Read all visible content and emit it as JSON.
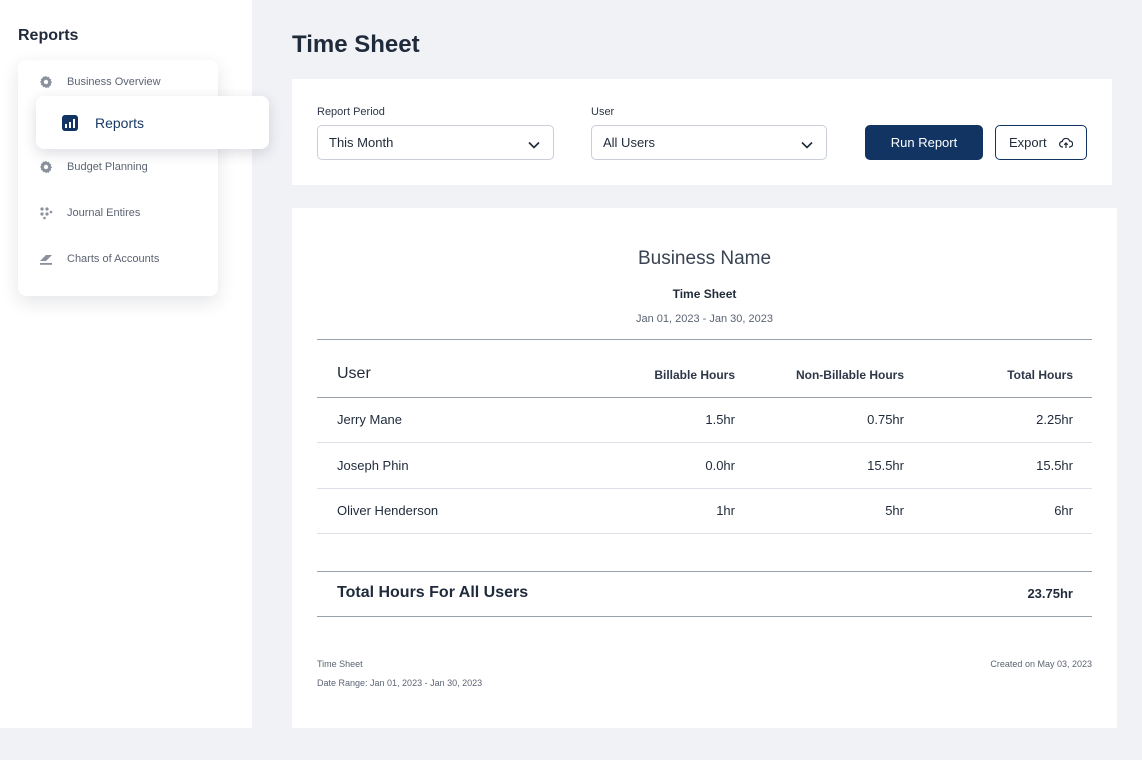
{
  "sidebar": {
    "title": "Reports",
    "items": [
      {
        "label": "Business Overview",
        "icon": "gear-icon"
      },
      {
        "label": "Reports",
        "icon": "bar-chart-icon",
        "active": true
      },
      {
        "label": "Budget Planning",
        "icon": "gear-icon"
      },
      {
        "label": "Journal Entires",
        "icon": "dots-grid-icon"
      },
      {
        "label": "Charts of Accounts",
        "icon": "layers-icon"
      }
    ]
  },
  "page": {
    "title": "Time Sheet"
  },
  "filters": {
    "period_label": "Report Period",
    "period_value": "This Month",
    "user_label": "User",
    "user_value": "All Users",
    "run_label": "Run Report",
    "export_label": "Export"
  },
  "report": {
    "business_name": "Business Name",
    "title": "Time Sheet",
    "range": "Jan 01, 2023 - Jan 30, 2023",
    "columns": [
      "User",
      "Billable Hours",
      "Non-Billable Hours",
      "Total Hours"
    ],
    "rows": [
      {
        "user": "Jerry Mane",
        "billable": "1.5hr",
        "non_billable": "0.75hr",
        "total": "2.25hr"
      },
      {
        "user": "Joseph Phin",
        "billable": "0.0hr",
        "non_billable": "15.5hr",
        "total": "15.5hr"
      },
      {
        "user": "Oliver Henderson",
        "billable": "1hr",
        "non_billable": "5hr",
        "total": "6hr"
      }
    ],
    "total_label": "Total Hours For All Users",
    "total_value": "23.75hr",
    "footer_title": "Time Sheet",
    "footer_range": "Date Range: Jan 01, 2023 - Jan 30, 2023",
    "footer_created": "Created on May 03, 2023"
  },
  "colors": {
    "accent": "#123463",
    "background": "#f1f2f6"
  }
}
